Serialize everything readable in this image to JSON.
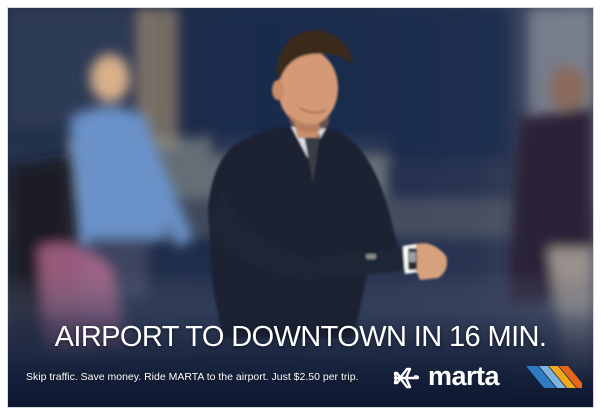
{
  "ad": {
    "headline": "AIRPORT TO DOWNTOWN IN 16 MIN.",
    "tagline": "Skip traffic. Save money. Ride MARTA to the airport. Just $2.50 per trip.",
    "brand": "marta",
    "icons": {
      "travel": "airplane-icon",
      "brand_mark": "marta-stripes-logo-icon"
    },
    "colors": {
      "stripe_blue": "#2f7cc4",
      "stripe_light_blue": "#7fb3e0",
      "stripe_gold": "#f2a81d",
      "stripe_orange": "#e8661c",
      "text": "#ffffff"
    }
  }
}
